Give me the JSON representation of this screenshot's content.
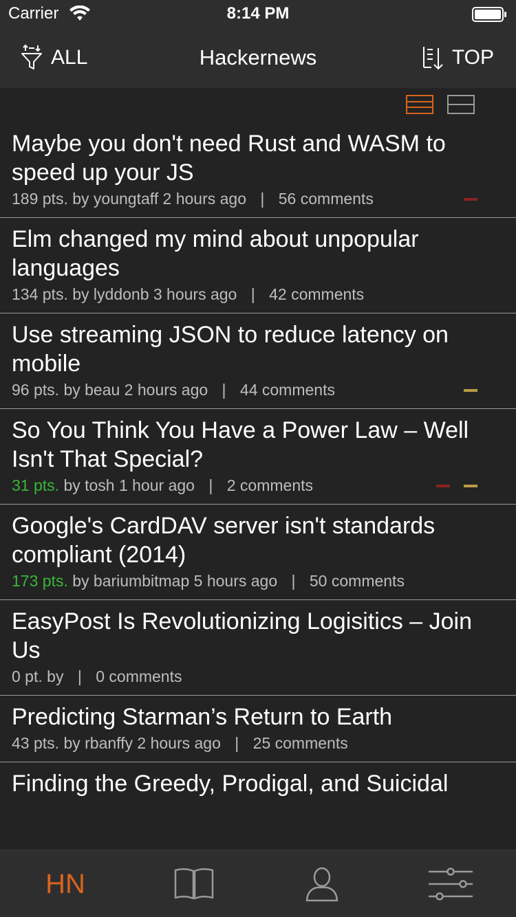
{
  "status_bar": {
    "carrier": "Carrier",
    "time": "8:14 PM"
  },
  "nav": {
    "filter_label": "ALL",
    "filter_icon": "funnel-icon",
    "title": "Hackernews",
    "sort_label": "TOP",
    "sort_icon": "sort-down-icon"
  },
  "view_toggle": {
    "active": "compact",
    "accent_color": "#d8641f"
  },
  "stories": [
    {
      "title": "Maybe you don't need Rust and WASM to speed up your JS",
      "pts": "189 pts.",
      "by": "by youngtaff 2 hours ago",
      "comments": "56 comments",
      "hot": false,
      "flags": [
        "red"
      ]
    },
    {
      "title": "Elm changed my mind about unpopular languages",
      "pts": "134 pts.",
      "by": "by lyddonb 3 hours ago",
      "comments": "42 comments",
      "hot": false,
      "flags": []
    },
    {
      "title": "Use streaming JSON to reduce latency on mobile",
      "pts": "96 pts.",
      "by": "by beau 2 hours ago",
      "comments": "44 comments",
      "hot": false,
      "flags": [
        "gold"
      ]
    },
    {
      "title": "So You Think You Have a Power Law – Well Isn't That Special?",
      "pts": "31 pts.",
      "by": "by tosh 1 hour ago",
      "comments": "2 comments",
      "hot": true,
      "flags": [
        "red",
        "gold"
      ]
    },
    {
      "title": "Google's CardDAV server isn't standards compliant (2014)",
      "pts": "173 pts.",
      "by": "by bariumbitmap 5 hours ago",
      "comments": "50 comments",
      "hot": true,
      "flags": []
    },
    {
      "title": "EasyPost Is Revolutionizing Logisitics – Join Us",
      "pts": "0 pt.",
      "by": "by",
      "comments": "0 comments",
      "hot": false,
      "flags": []
    },
    {
      "title": "Predicting Starman’s Return to Earth",
      "pts": "43 pts.",
      "by": "by rbanffy 2 hours ago",
      "comments": "25 comments",
      "hot": false,
      "flags": []
    },
    {
      "title": "Finding the Greedy, Prodigal, and Suicidal",
      "pts": "",
      "by": "",
      "comments": "",
      "hot": false,
      "flags": []
    }
  ],
  "tab_bar": {
    "hn_label": "HN",
    "reader_icon": "book-icon",
    "profile_icon": "person-icon",
    "settings_icon": "sliders-icon"
  }
}
